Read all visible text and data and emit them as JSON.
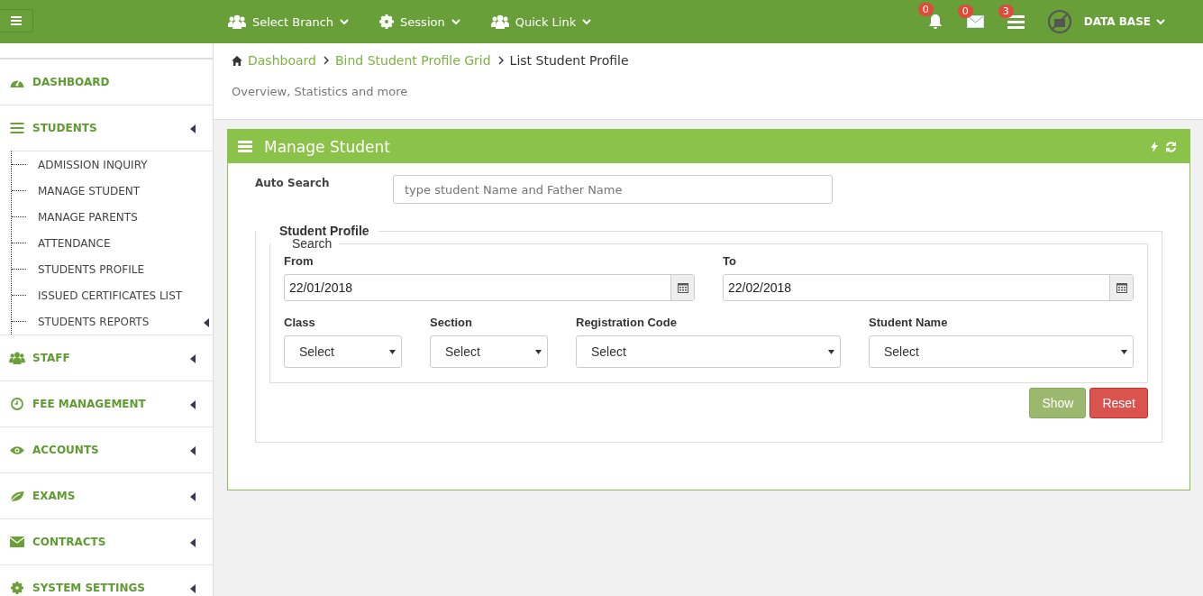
{
  "topbar": {
    "nav": [
      {
        "label": "Select Branch"
      },
      {
        "label": "Session"
      },
      {
        "label": "Quick Link"
      }
    ],
    "notifications": [
      {
        "count": "0"
      },
      {
        "count": "0"
      },
      {
        "count": "3"
      }
    ],
    "user": {
      "label": "DATA BASE"
    }
  },
  "sidebar": {
    "items": [
      {
        "label": "DASHBOARD",
        "kind": "link"
      },
      {
        "label": "STUDENTS",
        "kind": "menu",
        "children": [
          {
            "label": "ADMISSION INQUIRY",
            "expandable": false
          },
          {
            "label": "MANAGE STUDENT",
            "expandable": false
          },
          {
            "label": "MANAGE PARENTS",
            "expandable": false
          },
          {
            "label": "ATTENDANCE",
            "expandable": false
          },
          {
            "label": "STUDENTS PROFILE",
            "expandable": false
          },
          {
            "label": "ISSUED CERTIFICATES LIST",
            "expandable": false
          },
          {
            "label": "STUDENTS REPORTS",
            "expandable": true
          }
        ]
      },
      {
        "label": "STAFF",
        "kind": "menu"
      },
      {
        "label": "FEE MANAGEMENT",
        "kind": "menu"
      },
      {
        "label": "ACCOUNTS",
        "kind": "menu"
      },
      {
        "label": "EXAMS",
        "kind": "menu"
      },
      {
        "label": "CONTRACTS",
        "kind": "menu"
      },
      {
        "label": "SYSTEM SETTINGS",
        "kind": "menu"
      }
    ]
  },
  "breadcrumb": [
    {
      "label": "Dashboard"
    },
    {
      "label": "Bind Student Profile Grid"
    },
    {
      "label": "List Student Profile"
    }
  ],
  "page_subtitle": "Overview, Statistics and more",
  "panel": {
    "title": "Manage Student",
    "auto_search": {
      "label": "Auto Search",
      "placeholder": "type student Name and Father Name"
    },
    "profile_legend": "Student Profile",
    "search_legend": "Search",
    "dates": [
      {
        "label": "From",
        "value": "22/01/2018"
      },
      {
        "label": "To",
        "value": "22/02/2018"
      }
    ],
    "selects": [
      {
        "label": "Class",
        "value": "Select"
      },
      {
        "label": "Section",
        "value": "Select"
      },
      {
        "label": "Registration Code",
        "value": "Select"
      },
      {
        "label": "Student Name",
        "value": "Select"
      }
    ],
    "buttons": [
      {
        "label": "Show",
        "kind": "primary"
      },
      {
        "label": "Reset",
        "kind": "danger"
      }
    ]
  }
}
